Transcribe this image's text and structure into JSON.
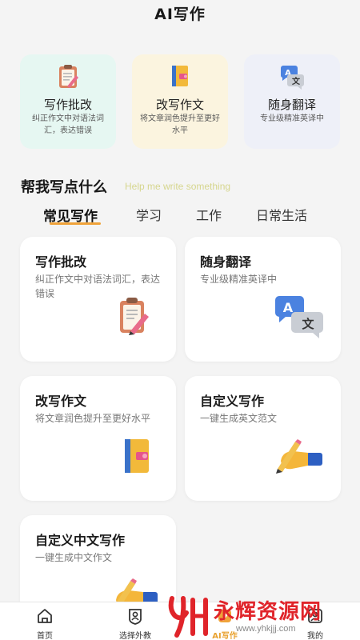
{
  "header": {
    "title": "AI写作"
  },
  "top_features": [
    {
      "title": "写作批改",
      "desc": "纠正作文中对语法词汇，表达错误",
      "icon": "clipboard-icon"
    },
    {
      "title": "改写作文",
      "desc": "将文章润色提升至更好水平",
      "icon": "notebook-icon"
    },
    {
      "title": "随身翻译",
      "desc": "专业级精准英译中",
      "icon": "translate-icon"
    }
  ],
  "section": {
    "title": "帮我写点什么",
    "subtitle": "Help me write something"
  },
  "tabs": [
    {
      "label": "常见写作",
      "active": true
    },
    {
      "label": "学习",
      "active": false
    },
    {
      "label": "工作",
      "active": false
    },
    {
      "label": "日常生活",
      "active": false
    }
  ],
  "cards": [
    {
      "title": "写作批改",
      "desc": "纠正作文中对语法词汇，表达错误",
      "icon": "clipboard-icon"
    },
    {
      "title": "随身翻译",
      "desc": "专业级精准英译中",
      "icon": "translate-icon"
    },
    {
      "title": "改写作文",
      "desc": "将文章润色提升至更好水平",
      "icon": "notebook-icon"
    },
    {
      "title": "自定义写作",
      "desc": "一键生成英文范文",
      "icon": "pencil-hand-icon"
    },
    {
      "title": "自定义中文写作",
      "desc": "一键生成中文作文",
      "icon": "pencil-hand-icon"
    }
  ],
  "bottom_nav": [
    {
      "label": "首页",
      "icon": "home-icon"
    },
    {
      "label": "选择外教",
      "icon": "teacher-icon"
    },
    {
      "label": "AI写作",
      "icon": "ai-write-icon",
      "active": true
    },
    {
      "label": "我的",
      "icon": "profile-icon"
    }
  ],
  "watermark": {
    "text": "永辉资源网",
    "url": "www.yhkjjj.com"
  },
  "colors": {
    "accent": "#f0a33a",
    "watermark": "#e0242a"
  }
}
